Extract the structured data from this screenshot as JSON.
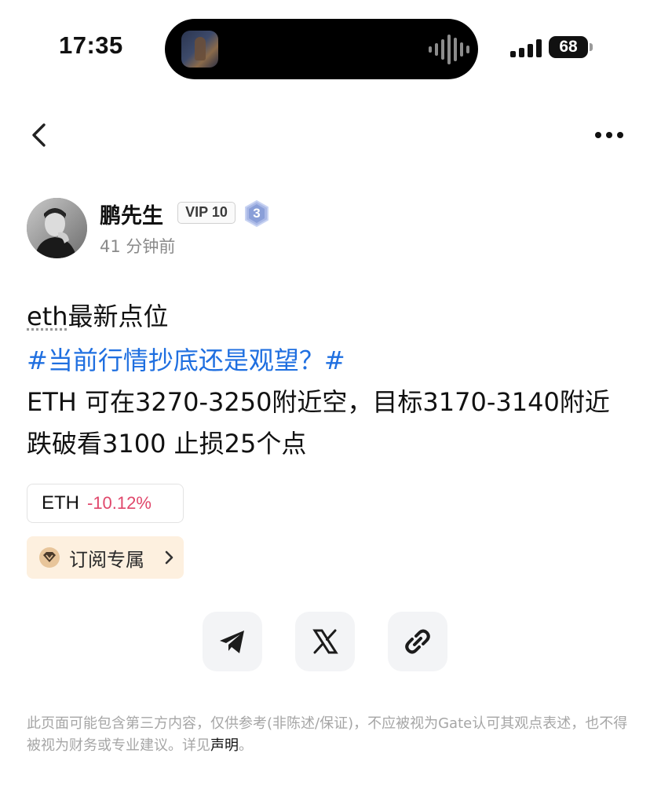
{
  "status_bar": {
    "time": "17:35",
    "battery": "68"
  },
  "nav": {
    "back_icon": "chevron-left-icon",
    "more_icon": "more-dots-icon"
  },
  "author": {
    "name": "鹏先生",
    "vip": "VIP 10",
    "level": "3",
    "posted": "41 分钟前"
  },
  "post": {
    "title_prefix": "eth",
    "title_suffix": "最新点位",
    "hashtag": "#当前行情抄底还是观望？#",
    "body": "ETH 可在3270-3250附近空，目标3170-3140附近跌破看3100 止损25个点"
  },
  "ticker": {
    "symbol": "ETH",
    "change": "-10.12%",
    "change_color": "#e0476b"
  },
  "subscribe": {
    "label": "订阅专属"
  },
  "share": {
    "telegram_icon": "telegram-icon",
    "x_icon": "x-icon",
    "link_icon": "link-icon"
  },
  "disclaimer": {
    "text": "此页面可能包含第三方内容，仅供参考(非陈述/保证)，不应被视为Gate认可其观点表述，也不得被视为财务或专业建议。详见",
    "link": "声明",
    "end": "。"
  }
}
